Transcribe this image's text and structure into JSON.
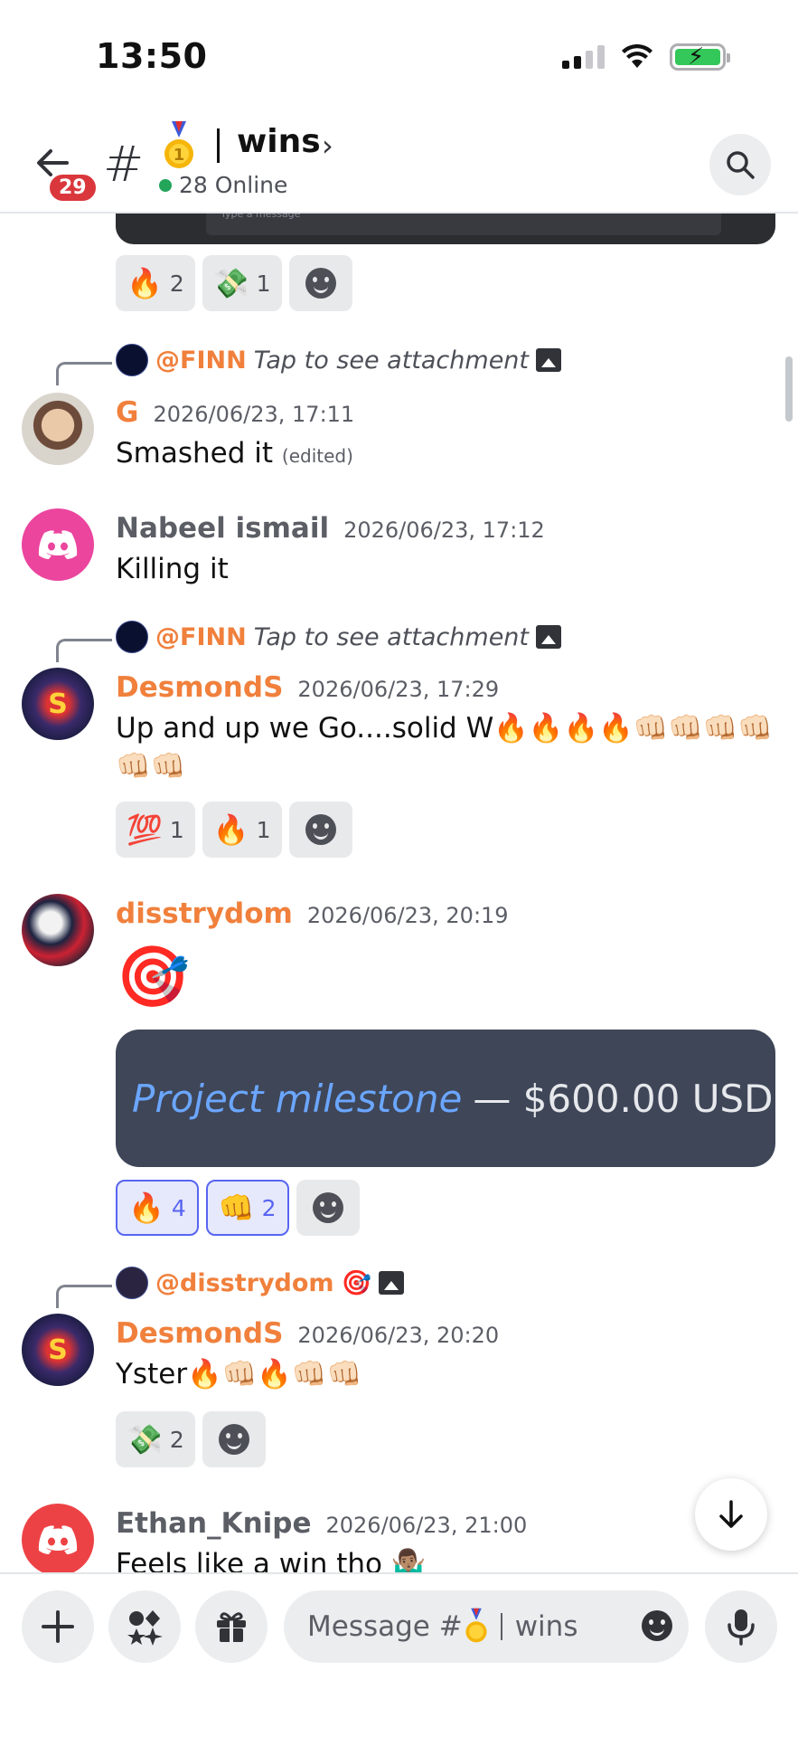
{
  "status_bar": {
    "time": "13:50"
  },
  "header": {
    "unread_badge": "29",
    "channel_hash": "#",
    "channel_name": "wins",
    "online": "28 Online"
  },
  "embed_top_placeholder": "Type a message",
  "top_reactions": [
    {
      "emoji": "🔥",
      "count": "2"
    },
    {
      "emoji": "💸",
      "count": "1"
    }
  ],
  "messages": [
    {
      "reply": {
        "mention": "@FINN",
        "text": "Tap to see attachment"
      },
      "author": "G",
      "timestamp": "2026/06/23, 17:11",
      "text": "Smashed it",
      "edited": "(edited)"
    },
    {
      "author": "Nabeel ismail",
      "timestamp": "2026/06/23, 17:12",
      "text": "Killing it"
    },
    {
      "reply": {
        "mention": "@FINN",
        "text": "Tap to see attachment"
      },
      "author": "DesmondS",
      "timestamp": "2026/06/23, 17:29",
      "text": "Up and up we Go....solid W🔥🔥🔥🔥👊🏻👊🏻👊🏻👊🏻👊🏻👊🏻",
      "reactions": [
        {
          "emoji": "💯",
          "count": "1"
        },
        {
          "emoji": "🔥",
          "count": "1"
        }
      ]
    },
    {
      "author": "disstrydom",
      "timestamp": "2026/06/23, 20:19",
      "text": "🎯",
      "embed": {
        "link": "Project milestone",
        "amount": "— $600.00 USD"
      },
      "reactions": [
        {
          "emoji": "🔥",
          "count": "4",
          "me": true
        },
        {
          "emoji": "👊",
          "count": "2",
          "me": true
        }
      ]
    },
    {
      "reply": {
        "mention": "@disstrydom",
        "text": "🎯"
      },
      "author": "DesmondS",
      "timestamp": "2026/06/23, 20:20",
      "text": "Yster🔥👊🏻🔥👊🏻👊🏻",
      "reactions": [
        {
          "emoji": "💸",
          "count": "2"
        }
      ]
    },
    {
      "author": "Ethan_Knipe",
      "timestamp": "2026/06/23, 21:00",
      "text": "Feels like a win tho 🤷🏽‍♂️"
    }
  ],
  "composer": {
    "placeholder_prefix": "Message #",
    "placeholder_channel": "wins"
  },
  "colors": {
    "accent": "#5865f2",
    "mention": "#f0803c",
    "online": "#23a55a",
    "badge": "#da373c"
  }
}
